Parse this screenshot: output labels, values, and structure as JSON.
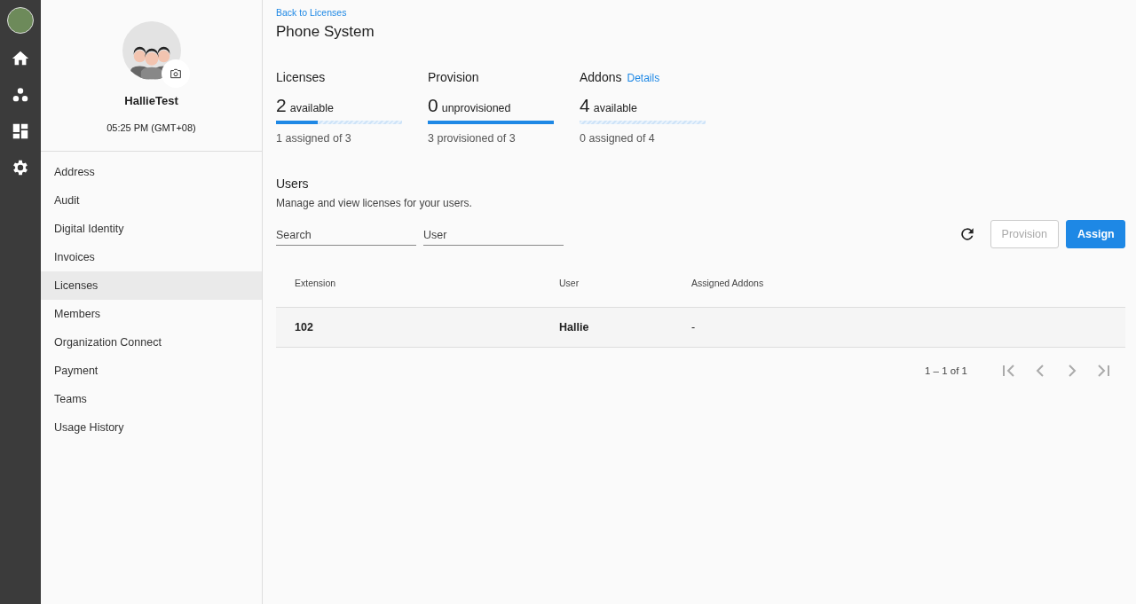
{
  "rail": {
    "items": [
      {
        "kind": "home"
      },
      {
        "kind": "org"
      },
      {
        "kind": "dashboard"
      },
      {
        "kind": "settings"
      }
    ]
  },
  "profile": {
    "name": "HallieTest",
    "time": "05:25 PM (GMT+08)"
  },
  "sidebar": {
    "items": [
      {
        "label": "Address",
        "selected": false
      },
      {
        "label": "Audit",
        "selected": false
      },
      {
        "label": "Digital Identity",
        "selected": false
      },
      {
        "label": "Invoices",
        "selected": false
      },
      {
        "label": "Licenses",
        "selected": true
      },
      {
        "label": "Members",
        "selected": false
      },
      {
        "label": "Organization Connect",
        "selected": false
      },
      {
        "label": "Payment",
        "selected": false
      },
      {
        "label": "Teams",
        "selected": false
      },
      {
        "label": "Usage History",
        "selected": false
      }
    ]
  },
  "back_link": "Back to Licenses",
  "title": "Phone System",
  "stats": [
    {
      "label": "Licenses",
      "count": "2",
      "unit": "available",
      "level": 0.3333,
      "caption": "1 assigned of 3"
    },
    {
      "label": "Provision",
      "count": "0",
      "unit": "unprovisioned",
      "level": 1,
      "caption": "3 provisioned of 3"
    },
    {
      "label": "Addons",
      "link": "Details",
      "count": "4",
      "unit": "available",
      "level": 0,
      "caption": "0 assigned of 4"
    }
  ],
  "users": {
    "title": "Users",
    "subtitle": "Manage and view licenses for your users.",
    "filters": [
      {
        "placeholder": "Search"
      },
      {
        "placeholder": "User"
      }
    ],
    "buttons": [
      {
        "label": "Provision",
        "disabled": true
      },
      {
        "label": "Assign",
        "disabled": false
      }
    ],
    "table": {
      "columns": [
        "Extension",
        "User",
        "Assigned Addons"
      ],
      "rows": [
        [
          "102",
          "Hallie",
          "-"
        ]
      ]
    },
    "pagination": {
      "range": "1 – 1 of 1",
      "first_disabled": true,
      "prev_disabled": true,
      "next_disabled": true,
      "last_disabled": true
    }
  }
}
